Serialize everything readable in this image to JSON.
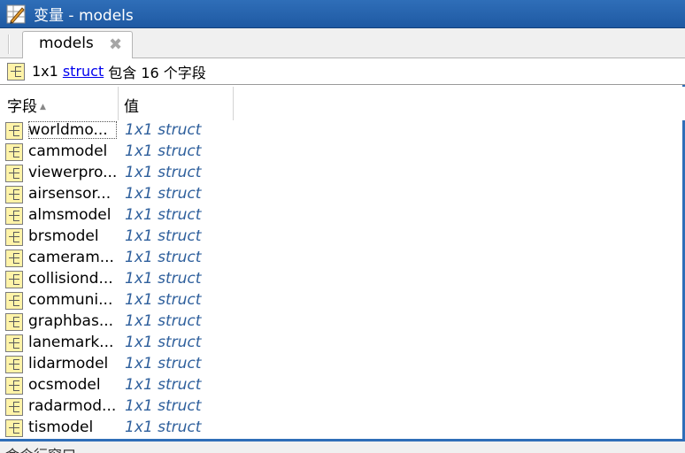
{
  "window": {
    "title": "变量 - models"
  },
  "tab": {
    "label": "models",
    "close_glyph": "✖"
  },
  "info": {
    "size": "1x1",
    "type_link": "struct",
    "description": "包含 16 个字段"
  },
  "columns": {
    "field": "字段",
    "value": "值",
    "sort_glyph": "▲"
  },
  "rows": [
    {
      "name": "worldmo...",
      "value": "1x1 struct"
    },
    {
      "name": "cammodel",
      "value": "1x1 struct"
    },
    {
      "name": "viewerpro...",
      "value": "1x1 struct"
    },
    {
      "name": "airsensor...",
      "value": "1x1 struct"
    },
    {
      "name": "almsmodel",
      "value": "1x1 struct"
    },
    {
      "name": "brsmodel",
      "value": "1x1 struct"
    },
    {
      "name": "cameram...",
      "value": "1x1 struct"
    },
    {
      "name": "collisiond...",
      "value": "1x1 struct"
    },
    {
      "name": "communi...",
      "value": "1x1 struct"
    },
    {
      "name": "graphbas...",
      "value": "1x1 struct"
    },
    {
      "name": "lanemark...",
      "value": "1x1 struct"
    },
    {
      "name": "lidarmodel",
      "value": "1x1 struct"
    },
    {
      "name": "ocsmodel",
      "value": "1x1 struct"
    },
    {
      "name": "radarmod...",
      "value": "1x1 struct"
    },
    {
      "name": "tismodel",
      "value": "1x1 struct"
    }
  ],
  "bottom": {
    "text": "命令行窗口"
  },
  "colors": {
    "title_bar": "#2f6eb8",
    "value_text": "#2e5f9c",
    "link": "#0000ee",
    "struct_icon_fill": "#fff3a8"
  },
  "icons": {
    "app": "variable-editor-icon",
    "struct": "struct-icon",
    "close": "close-icon",
    "sort": "sort-ascending-icon"
  }
}
